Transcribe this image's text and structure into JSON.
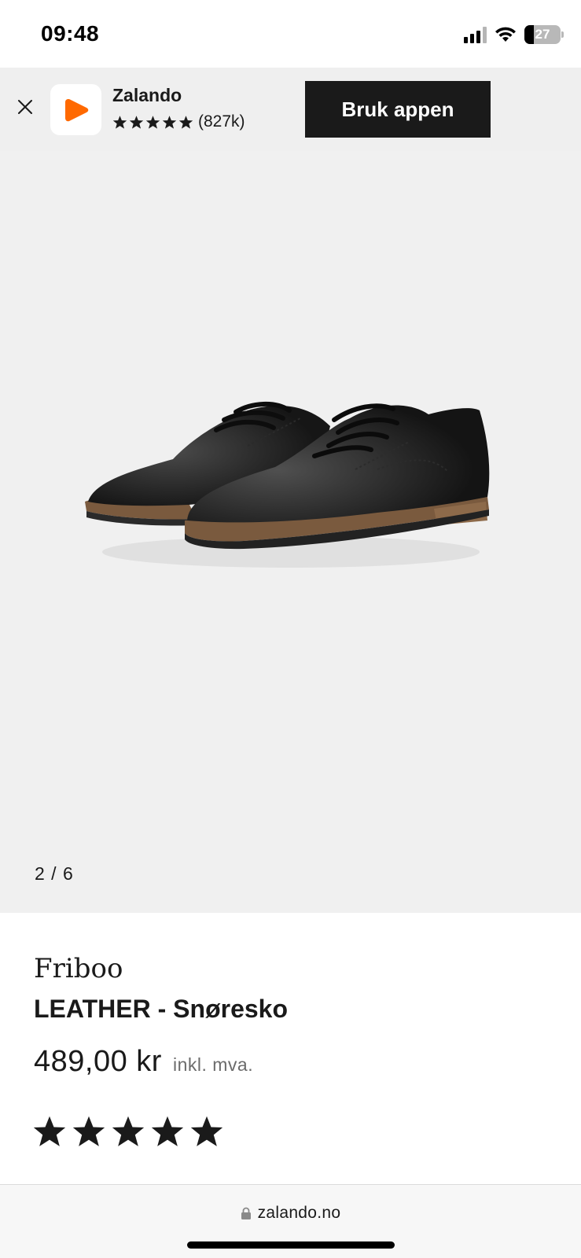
{
  "status_bar": {
    "time": "09:48",
    "battery_level": "27",
    "icons": [
      "cellular-signal-icon",
      "wifi-icon",
      "battery-icon"
    ]
  },
  "app_banner": {
    "app_name": "Zalando",
    "rating_count": "(827k)",
    "rating_stars": 5,
    "open_button_label": "Bruk appen",
    "brand_color": "#ff6900",
    "close_icon": "close-icon"
  },
  "gallery": {
    "counter": "2 / 6",
    "image_subject": "product-photo-shoes"
  },
  "product": {
    "brand": "Friboo",
    "title": "LEATHER - Snøresko",
    "price": "489,00 kr",
    "vat_note": "inkl. mva.",
    "rating_stars": 5
  },
  "browser": {
    "url": "zalando.no",
    "icons": [
      "lock-icon"
    ]
  },
  "colors": {
    "text": "#1a1a1a",
    "banner_bg": "#efefef",
    "gallery_bg": "#f0f0f0",
    "button_bg": "#1a1a1a",
    "muted_text": "#6b6b6b"
  }
}
